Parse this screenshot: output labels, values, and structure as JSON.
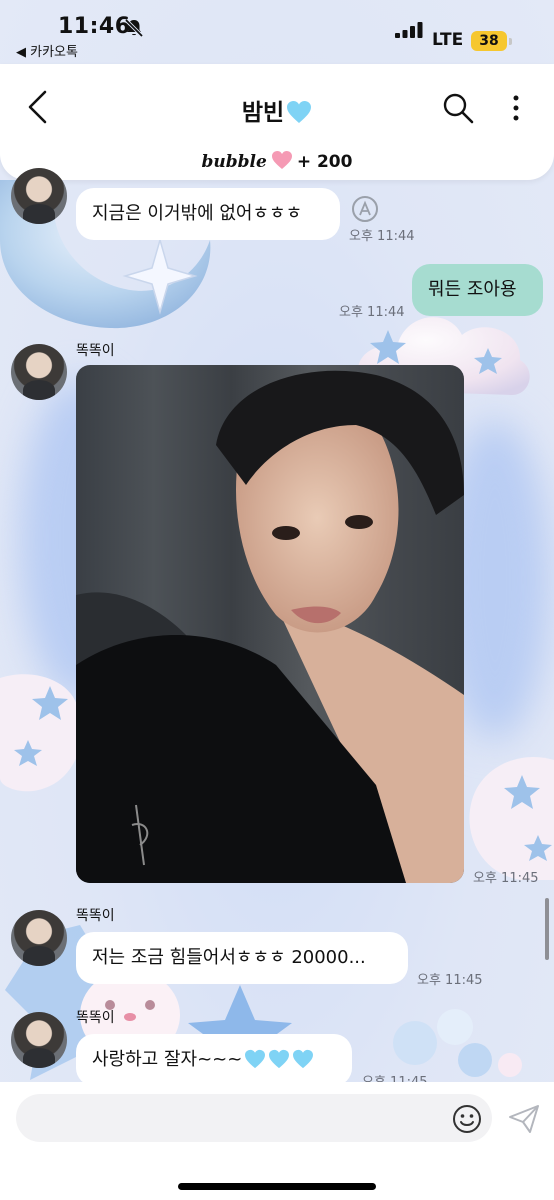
{
  "status_bar": {
    "time": "11:46",
    "back_app": "◀ 카카오톡",
    "network": "LTE",
    "battery": "38",
    "battery_color": "#f6c72f"
  },
  "header": {
    "title": "밤빈",
    "bubble_label": "bubble",
    "bubble_points": "+ 200"
  },
  "messages": [
    {
      "text": "지금은 이거밖에 없어ㅎㅎㅎ",
      "time": "오후 11:44"
    },
    {
      "text": "뭐든 조아용",
      "time": "오후 11:44",
      "mine": true
    },
    {
      "sender": "똑똑이",
      "type": "photo",
      "time": "오후 11:45"
    },
    {
      "sender": "똑똑이",
      "text": "저는 조금 힘들어서ㅎㅎㅎ 20000...",
      "time": "오후 11:45"
    },
    {
      "sender": "똑똑이",
      "text": "사랑하고 잘자~~~",
      "time": "오후 11:45"
    }
  ],
  "colors": {
    "my_bubble": "#a6dcd0",
    "their_bubble": "#ffffff",
    "background": "#dfe6f6"
  },
  "icons": [
    "bell-slash-icon",
    "back-chevron-icon",
    "search-icon",
    "more-vertical-icon",
    "translate-icon",
    "emoji-icon",
    "send-icon"
  ]
}
